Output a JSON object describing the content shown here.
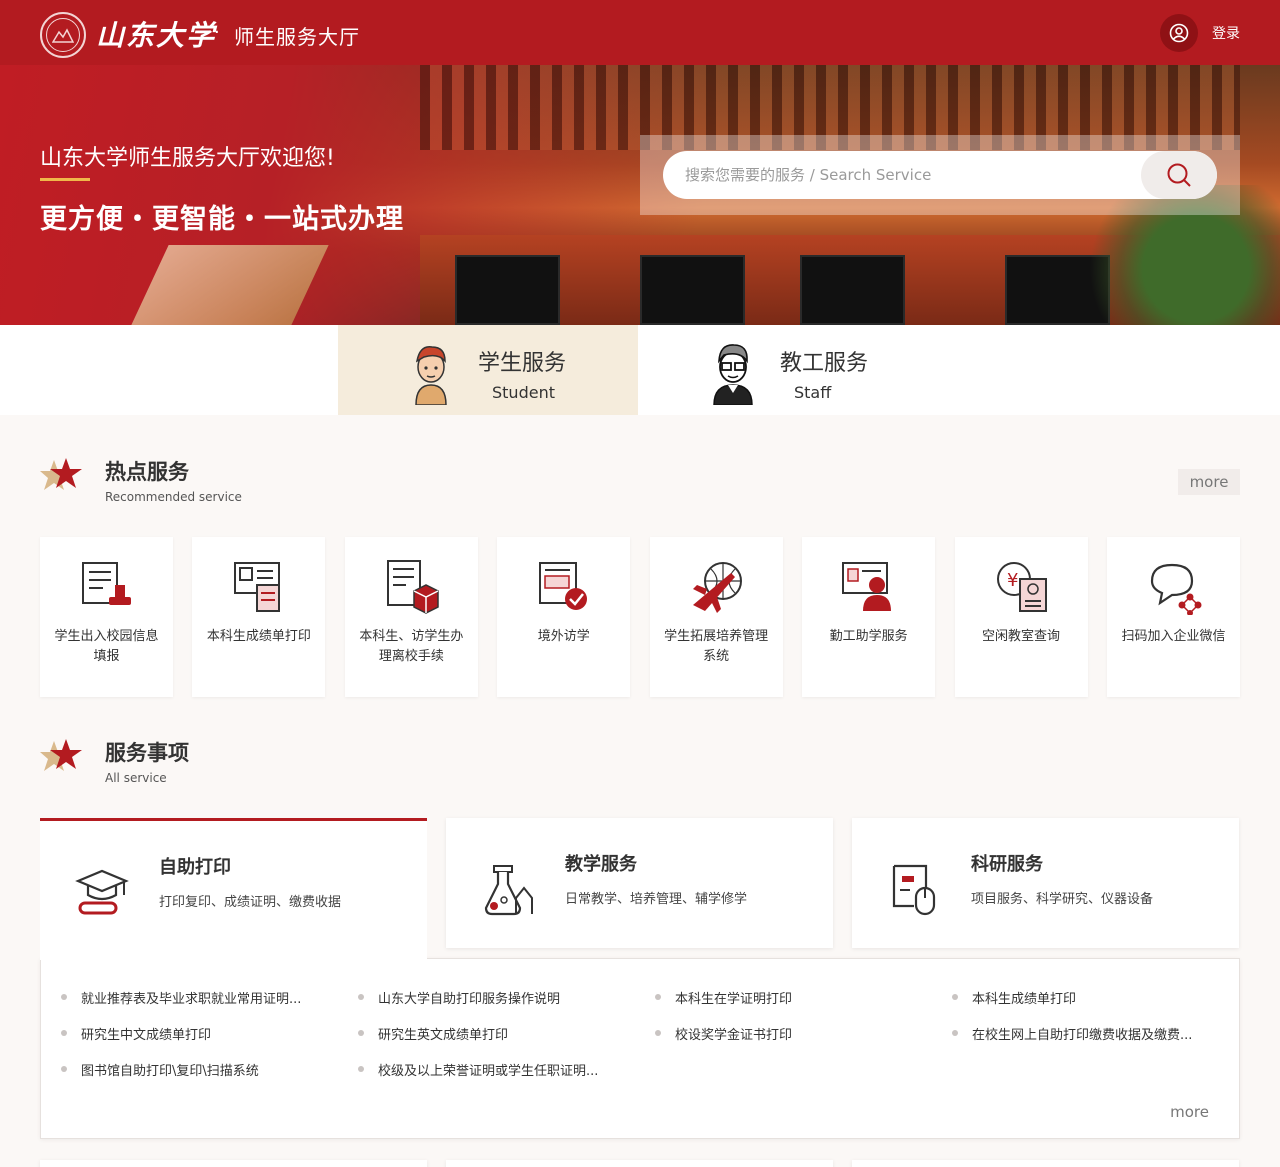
{
  "header": {
    "logo_name": "山东大学",
    "separator": "·",
    "portal_title": "师生服务大厅",
    "login_label": "登录"
  },
  "banner": {
    "welcome": "山东大学师生服务大厅欢迎您!",
    "slogan": "更方便・更智能・一站式办理",
    "search_placeholder": "搜索您需要的服务 / Search Service"
  },
  "roles": [
    {
      "cn": "学生服务",
      "en": "Student",
      "active": true
    },
    {
      "cn": "教工服务",
      "en": "Staff",
      "active": false
    }
  ],
  "hot": {
    "title": "热点服务",
    "subtitle": "Recommended service",
    "more": "more",
    "items": [
      {
        "label": "学生出入校园信息填报",
        "icon": "form-stamp-icon"
      },
      {
        "label": "本科生成绩单打印",
        "icon": "transcript-print-icon"
      },
      {
        "label": "本科生、访学生办理离校手续",
        "icon": "document-box-icon"
      },
      {
        "label": "境外访学",
        "icon": "approved-document-icon"
      },
      {
        "label": "学生拓展培养管理系统",
        "icon": "airplane-globe-icon"
      },
      {
        "label": "勤工助学服务",
        "icon": "worker-screen-icon"
      },
      {
        "label": "空闲教室查询",
        "icon": "classroom-query-icon"
      },
      {
        "label": "扫码加入企业微信",
        "icon": "chat-network-icon"
      }
    ]
  },
  "all": {
    "title": "服务事项",
    "subtitle": "All service",
    "categories": [
      {
        "title": "自助打印",
        "desc": "打印复印、成绩证明、缴费收据",
        "icon": "graduation-cap-icon",
        "active": true
      },
      {
        "title": "教学服务",
        "desc": "日常教学、培养管理、辅学修学",
        "icon": "flask-icon",
        "active": false
      },
      {
        "title": "科研服务",
        "desc": "项目服务、科学研究、仪器设备",
        "icon": "research-device-icon",
        "active": false
      }
    ],
    "links": [
      "就业推荐表及毕业求职就业常用证明...",
      "山东大学自助打印服务操作说明",
      "本科生在学证明打印",
      "本科生成绩单打印",
      "研究生中文成绩单打印",
      "研究生英文成绩单打印",
      "校设奖学金证书打印",
      "在校生网上自助打印缴费收据及缴费...",
      "图书馆自助打印\\复印\\扫描系统",
      "校级及以上荣誉证明或学生任职证明..."
    ],
    "panel_more": "more"
  },
  "colors": {
    "brand": "#b31b20",
    "active_tab": "#f5ecdc",
    "page_bg": "#fbf8f6"
  }
}
